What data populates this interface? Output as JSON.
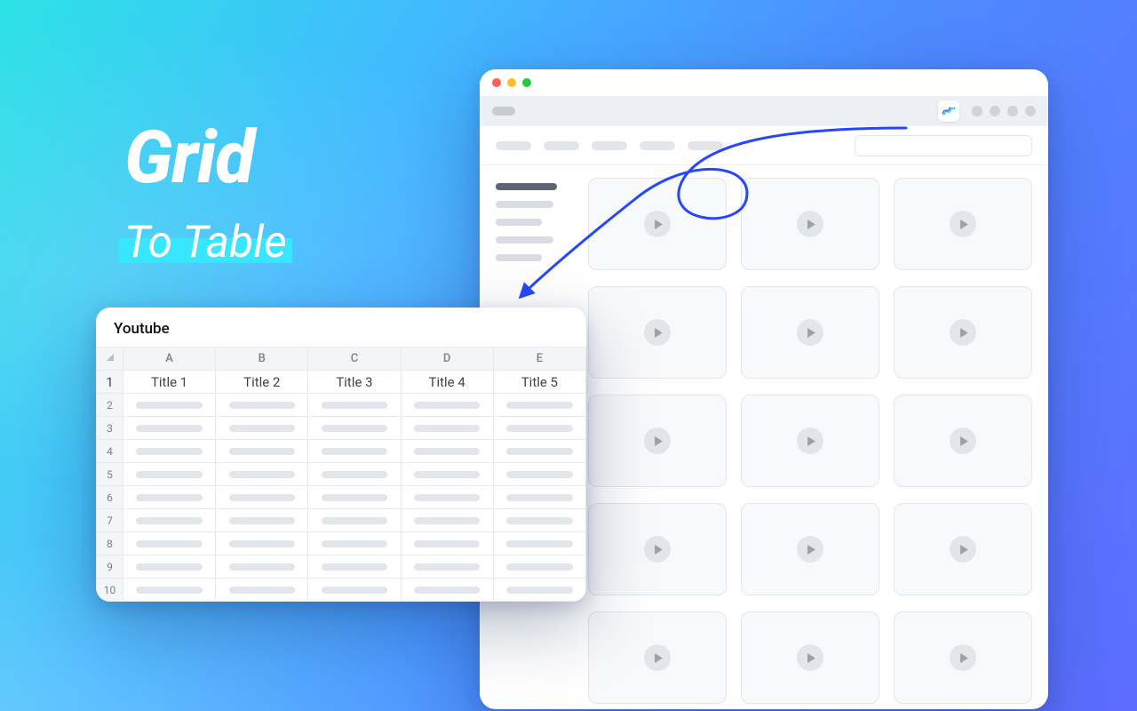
{
  "headline": {
    "line1": "Grid",
    "line2": "To Table"
  },
  "spreadsheet": {
    "title": "Youtube",
    "col_letters": [
      "A",
      "B",
      "C",
      "D",
      "E"
    ],
    "header_row_num": "1",
    "headers": [
      "Title 1",
      "Title 2",
      "Title 3",
      "Title 4",
      "Title 5"
    ],
    "row_numbers": [
      "2",
      "3",
      "4",
      "5",
      "6",
      "7",
      "8",
      "9",
      "10"
    ]
  },
  "browser": {
    "extension_name": "scrape-icon",
    "video_card_count": 15
  }
}
